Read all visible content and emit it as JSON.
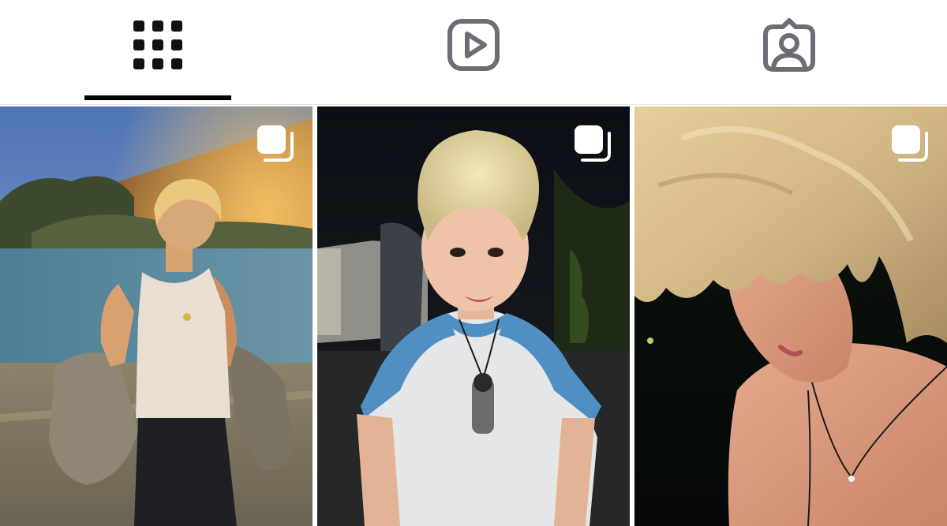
{
  "tabs": [
    {
      "id": "posts",
      "icon": "grid-icon",
      "label": "Posts",
      "active": true
    },
    {
      "id": "reels",
      "icon": "reels-play-icon",
      "label": "Reels",
      "active": false
    },
    {
      "id": "tagged",
      "icon": "tagged-person-icon",
      "label": "Tagged",
      "active": false
    }
  ],
  "colors": {
    "active_indicator": "#000000",
    "inactive_icon": "#6b6e75",
    "active_icon": "#111111",
    "badge": "#ffffff"
  },
  "posts": [
    {
      "subject": "blond man in white tank top at sunset outdoors",
      "badge_icon": "carousel-icon"
    },
    {
      "subject": "blond man in white and blue tee at night",
      "badge_icon": "carousel-icon"
    },
    {
      "subject": "close-up of blond man looking down at night",
      "badge_icon": "carousel-icon"
    }
  ]
}
